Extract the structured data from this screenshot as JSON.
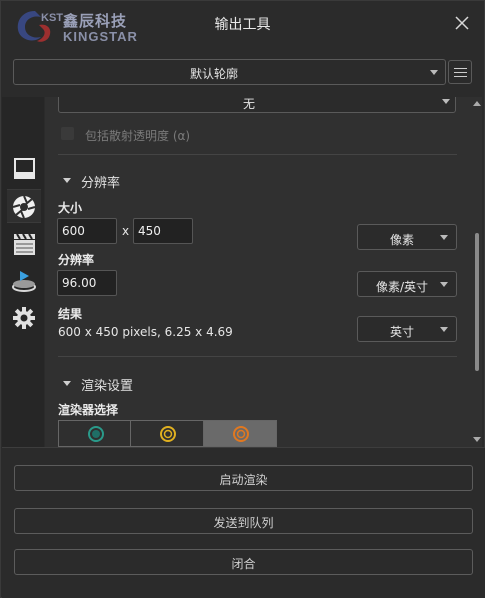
{
  "window": {
    "title": "输出工具",
    "logo_text_cn": "鑫辰科技",
    "logo_text_en": "KINGSTAR",
    "logo_badge": "KST"
  },
  "profile": {
    "selected": "默认轮廓"
  },
  "sidebar": {
    "tabs": [
      {
        "name": "frame-tab",
        "icon": "frame-icon"
      },
      {
        "name": "camera-aperture-tab",
        "icon": "aperture-icon",
        "active": true
      },
      {
        "name": "clapperboard-tab",
        "icon": "clapperboard-icon"
      },
      {
        "name": "turntable-tab",
        "icon": "turntable-icon"
      },
      {
        "name": "gear-tab",
        "icon": "gear-icon"
      }
    ]
  },
  "panel": {
    "top_dropdown": "无",
    "scatter_checkbox_label": "包括散射透明度 (α)",
    "resolution": {
      "section_title": "分辨率",
      "size_label": "大小",
      "width": "600",
      "times": "x",
      "height": "450",
      "size_unit": "像素",
      "resolution_label": "分辨率",
      "resolution_value": "96.00",
      "resolution_unit": "像素/英寸",
      "result_label": "结果",
      "result_value": "600 x 450 pixels, 6.25 x 4.69",
      "result_unit": "英寸"
    },
    "render": {
      "section_title": "渲染设置",
      "renderer_label": "渲染器选择",
      "renderer_colors": [
        "#2a9a8a",
        "#e0b020",
        "#e07820"
      ]
    }
  },
  "buttons": {
    "start_render": "启动渲染",
    "send_queue": "发送到队列",
    "close": "闭合"
  }
}
